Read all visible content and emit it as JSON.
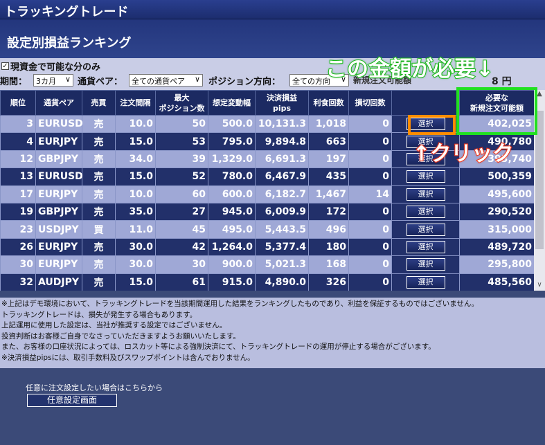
{
  "app": {
    "title": "トラッキングトレード"
  },
  "page": {
    "title": "設定別損益ランキング"
  },
  "filters": {
    "cash_checkbox": "現資金で可能な分のみ",
    "period_label": "期間：",
    "period_value": "3カ月",
    "pair_label": "通貨ペア：",
    "pair_value": "全ての通貨ペア",
    "direction_label": "ポジション方向：",
    "direction_value": "全ての方向",
    "partial_hidden_text": "新規注文可能額",
    "amount_tail": "8 円"
  },
  "table": {
    "headers": [
      "順位",
      "通貨ペア",
      "売買",
      "注文間隔",
      "最大\nポジション数",
      "想定変動幅",
      "決済損益\npips",
      "利食回数",
      "損切回数",
      "",
      "必要な\n新規注文可能額"
    ],
    "select_label": "選択",
    "rows": [
      [
        "3",
        "EURUSD",
        "売",
        "10.0",
        "50",
        "500.0",
        "10,131.3",
        "1,018",
        "0",
        "402,025"
      ],
      [
        "4",
        "EURJPY",
        "売",
        "15.0",
        "53",
        "795.0",
        "9,894.8",
        "663",
        "0",
        "490,780"
      ],
      [
        "12",
        "GBPJPY",
        "売",
        "34.0",
        "39",
        "1,329.0",
        "6,691.3",
        "197",
        "0",
        "393,740"
      ],
      [
        "13",
        "EURUSD",
        "売",
        "15.0",
        "52",
        "780.0",
        "6,467.9",
        "435",
        "0",
        "500,359"
      ],
      [
        "17",
        "EURJPY",
        "売",
        "10.0",
        "60",
        "600.0",
        "6,182.7",
        "1,467",
        "14",
        "495,600"
      ],
      [
        "19",
        "GBPJPY",
        "売",
        "35.0",
        "27",
        "945.0",
        "6,009.9",
        "172",
        "0",
        "290,520"
      ],
      [
        "23",
        "USDJPY",
        "買",
        "11.0",
        "45",
        "495.0",
        "5,443.5",
        "496",
        "0",
        "315,000"
      ],
      [
        "26",
        "EURJPY",
        "売",
        "30.0",
        "42",
        "1,264.0",
        "5,377.4",
        "180",
        "0",
        "489,720"
      ],
      [
        "30",
        "EURJPY",
        "売",
        "30.0",
        "30",
        "900.0",
        "5,021.3",
        "168",
        "0",
        "295,800"
      ],
      [
        "32",
        "AUDJPY",
        "売",
        "15.0",
        "61",
        "915.0",
        "4,890.0",
        "326",
        "0",
        "485,560"
      ]
    ]
  },
  "notes": [
    "※上記はデモ環境において、トラッキングトレードを当該期間運用した結果をランキングしたものであり、利益を保証するものではございません。",
    "トラッキングトレードは、損失が発生する場合もあります。",
    "上記運用に使用した設定は、当社が推奨する設定ではございません。",
    "投資判断はお客様ご自身でなさっていただきますようお願いいたします。",
    "また、お客様の口座状況によっては、ロスカット等による強制決済にて、トラッキングトレードの運用が停止する場合がございます。",
    "※決済損益pipsには、取引手数料及びスワップポイントは含んでおりません。"
  ],
  "bottom": {
    "label": "任意に注文設定したい場合はこちらから",
    "button": "任意設定画面"
  },
  "annotations": {
    "amount_needed": "この金額が必要↓",
    "click": "↑クリック",
    "green_color": "#21e021",
    "orange_color": "#ff8c00"
  }
}
